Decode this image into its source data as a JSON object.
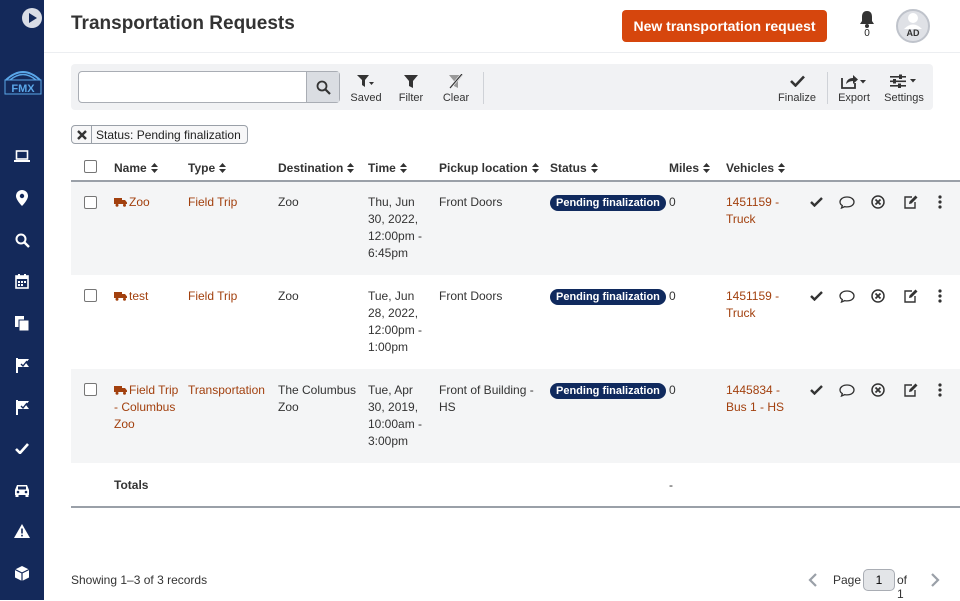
{
  "header": {
    "title": "Transportation Requests",
    "new_button": "New transportation request",
    "notification_count": "0",
    "avatar_initials": "AD"
  },
  "sidebar": {
    "logo_text": "FMX",
    "items": [
      "laptop-icon",
      "location-pin-icon",
      "search-icon",
      "calendar-icon",
      "documents-icon",
      "flag-icon",
      "flag-check-icon",
      "check-icon",
      "car-icon",
      "warning-icon",
      "box-icon"
    ]
  },
  "toolbar": {
    "search": {
      "value": "",
      "placeholder": ""
    },
    "saved": "Saved",
    "filter": "Filter",
    "clear": "Clear",
    "finalize": "Finalize",
    "export": "Export",
    "settings": "Settings"
  },
  "filter_chip": "Status: Pending finalization",
  "table": {
    "columns": [
      "Name",
      "Type",
      "Destination",
      "Time",
      "Pickup location",
      "Status",
      "Miles",
      "Vehicles"
    ],
    "rows": [
      {
        "name": "Zoo",
        "type": "Field Trip",
        "destination": "Zoo",
        "time": "Thu, Jun 30, 2022, 12:00pm - 6:45pm",
        "pickup": "Front Doors",
        "status": "Pending finalization",
        "miles": "0",
        "vehicles": "1451159 - Truck"
      },
      {
        "name": "test",
        "type": "Field Trip",
        "destination": "Zoo",
        "time": "Tue, Jun 28, 2022, 12:00pm - 1:00pm",
        "pickup": "Front Doors",
        "status": "Pending finalization",
        "miles": "0",
        "vehicles": "1451159 - Truck"
      },
      {
        "name": "Field Trip - Columbus Zoo",
        "type": "Transportation",
        "destination": "The Columbus Zoo",
        "time": "Tue, Apr 30, 2019, 10:00am - 3:00pm",
        "pickup": "Front of Building - HS",
        "status": "Pending finalization",
        "miles": "0",
        "vehicles": "1445834 - Bus 1 - HS"
      }
    ],
    "totals_label": "Totals",
    "totals_miles": "-"
  },
  "footer": {
    "records": "Showing 1–3 of 3 records",
    "page_label": "Page",
    "page_value": "1",
    "page_of": "of 1"
  },
  "colors": {
    "sidebar": "#14295a",
    "accent": "#d6460d",
    "link": "#a2400e",
    "badge": "#102a5e"
  }
}
